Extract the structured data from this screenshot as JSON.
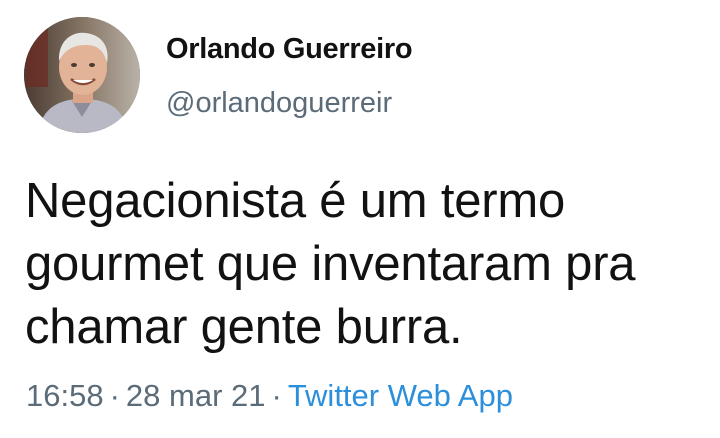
{
  "tweet": {
    "author": {
      "display_name": "Orlando Guerreiro",
      "handle": "@orlandoguerreir",
      "avatar_icon": "profile-photo"
    },
    "text": "Negacionista é um termo\ngourmet que inventaram pra\nchamar gente burra.",
    "time": "16:58",
    "date": "28 mar 21",
    "separator": "·",
    "source": "Twitter Web App"
  },
  "colors": {
    "text": "#121212",
    "secondary": "#5b6b78",
    "link": "#2b8fdc",
    "background": "#ffffff"
  }
}
